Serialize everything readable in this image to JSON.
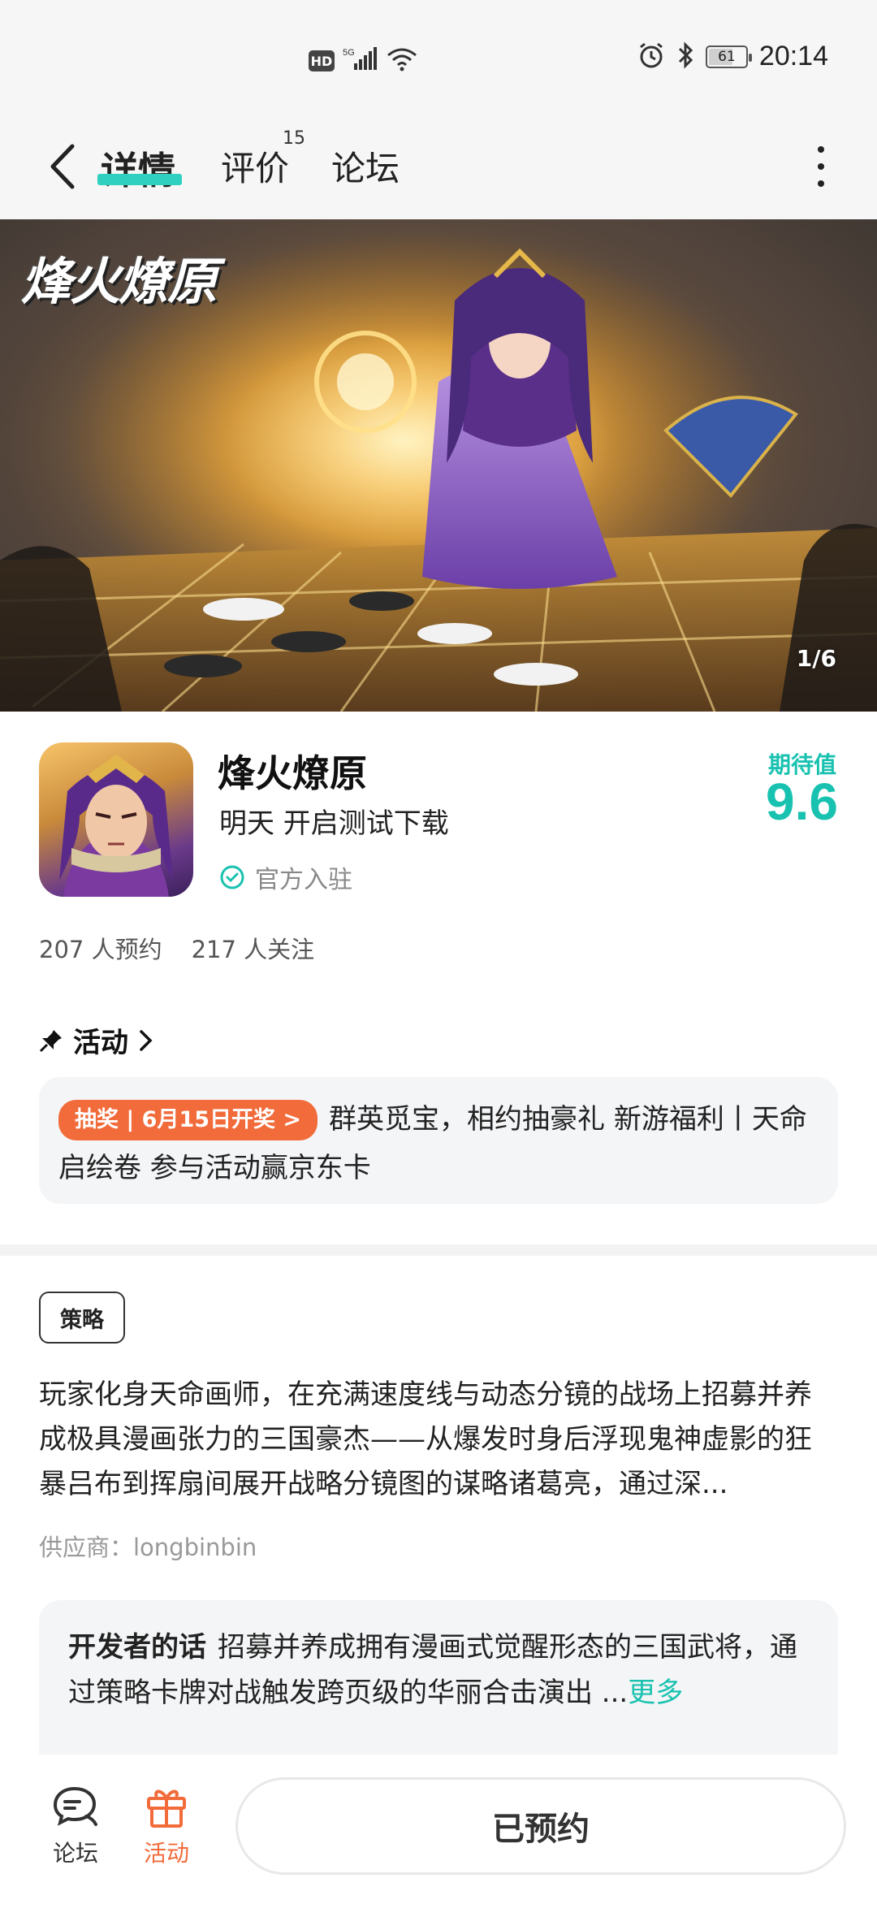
{
  "status_bar": {
    "network_badge": "HD",
    "network_type": "5G",
    "battery": "61",
    "time": "20:14"
  },
  "header": {
    "tabs": [
      {
        "label": "详情",
        "active": true
      },
      {
        "label": "评价",
        "count": "15"
      },
      {
        "label": "论坛"
      }
    ]
  },
  "banner": {
    "logo_text": "烽火燎原",
    "counter": "1/6"
  },
  "game": {
    "title": "烽火燎原",
    "subtitle": "明天 开启测试下载",
    "official_label": "官方入驻",
    "expect_label": "期待值",
    "expect_score": "9.6",
    "reservations": "207 人预约",
    "followers": "217 人关注"
  },
  "activity": {
    "heading": "活动",
    "pill": "抽奖 | 6月15日开奖 >",
    "text": "群英觅宝，相约抽豪礼 新游福利丨天命启绘卷 参与活动赢京东卡"
  },
  "strategy": {
    "tag": "策略",
    "description": "玩家化身天命画师，在充满速度线与动态分镜的战场上招募并养成极具漫画张力的三国豪杰——从爆发时身后浮现鬼神虚影的狂暴吕布到挥扇间展开战略分镜图的谋略诸葛亮，通过深...",
    "supplier": "供应商：longbinbin"
  },
  "developer": {
    "title": "开发者的话",
    "text": "招募并养成拥有漫画式觉醒形态的三国武将，通过策略卡牌对战触发跨页级的华丽合击演出 ...",
    "more": "更多"
  },
  "bottom_bar": {
    "forum_label": "论坛",
    "activity_label": "活动",
    "reserve_label": "已预约"
  },
  "colors": {
    "accent": "#19c2b0",
    "orange": "#f26b3a"
  }
}
